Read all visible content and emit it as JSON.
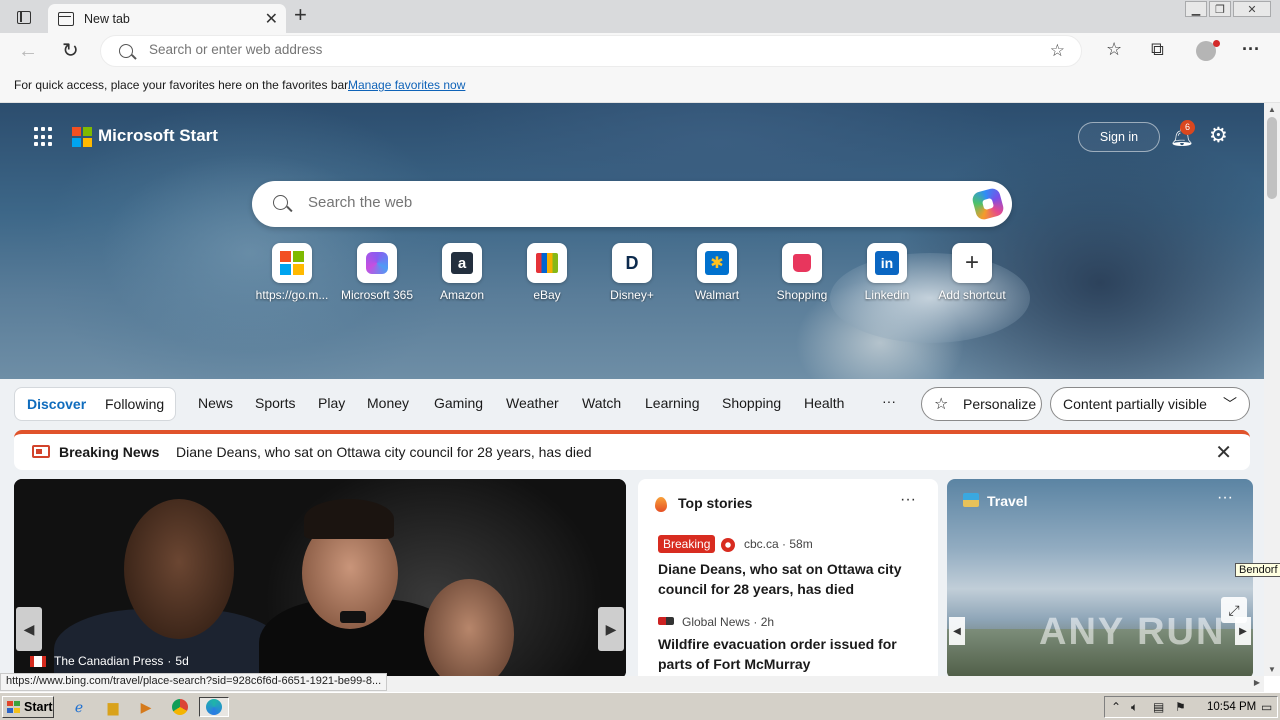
{
  "browser": {
    "tab_title": "New tab",
    "address_placeholder": "Search or enter web address",
    "favorites_bar": {
      "text": "For quick access, place your favorites here on the favorites bar.",
      "link": "Manage favorites now"
    },
    "status_url": "https://www.bing.com/travel/place-search?sid=928c6f6d-6651-1921-be99-8..."
  },
  "start_page": {
    "brand": "Microsoft Start",
    "sign_in": "Sign in",
    "notification_count": "6",
    "search_placeholder": "Search the web",
    "shortcuts": [
      {
        "label": "https://go.m...",
        "icon": "windows-icon"
      },
      {
        "label": "Microsoft 365",
        "icon": "m365-icon"
      },
      {
        "label": "Amazon",
        "icon": "amazon-icon"
      },
      {
        "label": "eBay",
        "icon": "ebay-bag-icon"
      },
      {
        "label": "Disney+",
        "icon": "disney-icon"
      },
      {
        "label": "Walmart",
        "icon": "walmart-icon"
      },
      {
        "label": "Shopping",
        "icon": "shopping-bag-icon"
      },
      {
        "label": "Linkedin",
        "icon": "linkedin-icon"
      },
      {
        "label": "Add shortcut",
        "icon": "plus-icon"
      }
    ],
    "feed_nav": {
      "discover": "Discover",
      "following": "Following",
      "items": [
        "News",
        "Sports",
        "Play",
        "Money",
        "Gaming",
        "Weather",
        "Watch",
        "Learning",
        "Shopping",
        "Health"
      ],
      "more": "···",
      "personalize": "Personalize",
      "visibility": "Content partially visible"
    },
    "breaking_news": {
      "label": "Breaking News",
      "headline": "Diane Deans, who sat on Ottawa city council for 28 years, has died"
    },
    "photo_card": {
      "source": "The Canadian Press",
      "age": "5d"
    },
    "top_stories": {
      "title": "Top stories",
      "more": "···",
      "stories": [
        {
          "badge": "Breaking",
          "source": "cbc.ca · 58m",
          "title": "Diane Deans, who sat on Ottawa city council for 28 years, has died"
        },
        {
          "source": "Global News · 2h",
          "title": "Wildfire evacuation order issued for parts of Fort McMurray"
        }
      ]
    },
    "travel": {
      "title": "Travel",
      "more": "···",
      "tooltip": "Bendorf",
      "watermark": "ANY RUN"
    }
  },
  "taskbar": {
    "start": "Start",
    "clock": "10:54 PM"
  },
  "colors": {
    "accent": "#0f6cbd",
    "breaking_red": "#d82c20",
    "link_blue": "#0f63b8"
  }
}
